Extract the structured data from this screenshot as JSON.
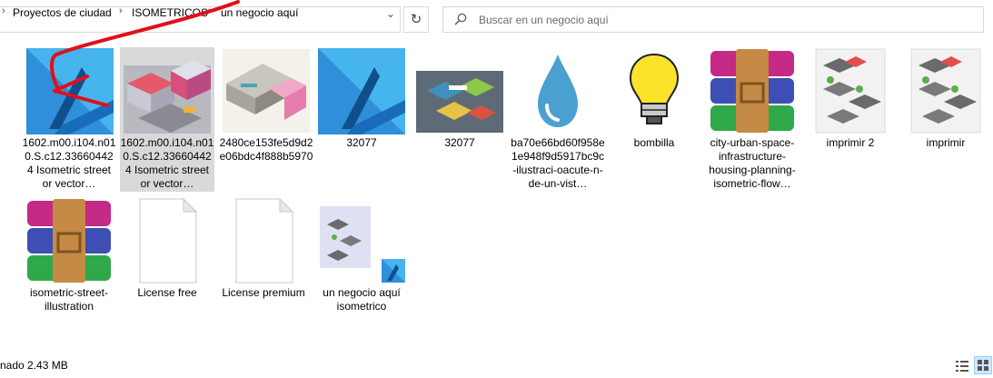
{
  "address_bar": {
    "crumbs": [
      "Proyectos de ciudad",
      "ISOMETRICOS",
      "un negocio aquí"
    ],
    "separator": "›",
    "dropdown_glyph": "⌄",
    "refresh_glyph": "↻"
  },
  "search": {
    "placeholder": "Buscar en un negocio aquí"
  },
  "files": [
    {
      "label": "1602.m00.i104.n010.S.c12.336604424 Isometric street or vector…",
      "icon": "affinity-designer-icon"
    },
    {
      "label": "1602.m00.i104.n010.S.c12.336604424 Isometric street or vector…",
      "icon": "isometric-street-thumbnail",
      "selected": true
    },
    {
      "label": "2480ce153fe5d9d2e06bdc4f888b5970",
      "icon": "isometric-building-thumbnail"
    },
    {
      "label": "32077",
      "icon": "affinity-designer-icon"
    },
    {
      "label": "32077",
      "icon": "urban-space-thumbnail"
    },
    {
      "label": "ba70e66bd60f958e1e948f9d5917bc9c-ilustraci-oacute-n-de-un-vist…",
      "icon": "water-drop-thumbnail"
    },
    {
      "label": "bombilla",
      "icon": "light-bulb-thumbnail"
    },
    {
      "label": "city-urban-space-infrastructure-housing-planning-isometric-flow…",
      "icon": "winrar-archive-icon"
    },
    {
      "label": "imprimir 2",
      "icon": "isometric-print-thumbnail"
    },
    {
      "label": "imprimir",
      "icon": "isometric-print-thumbnail"
    },
    {
      "label": "isometric-street-illustration",
      "icon": "winrar-archive-icon"
    },
    {
      "label": "License free",
      "icon": "text-document-icon"
    },
    {
      "label": "License premium",
      "icon": "text-document-icon"
    },
    {
      "label": "un negocio aquí isometrico",
      "icon": "affinity-file-thumbnail"
    }
  ],
  "status": {
    "text": "nado  2.43 MB"
  },
  "colors": {
    "selection": "#d9d9d9",
    "affinity_blue": "#3aa3e0",
    "annotation_red": "#e0101a"
  }
}
